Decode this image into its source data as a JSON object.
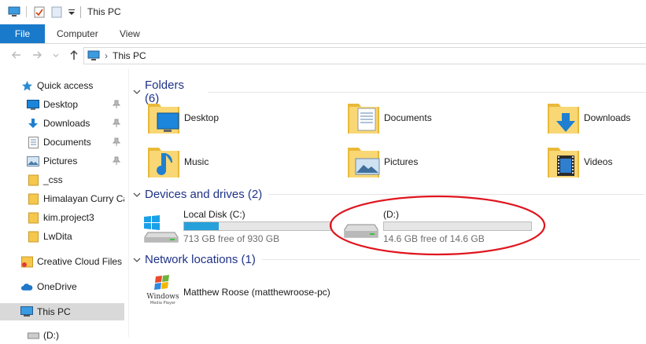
{
  "window": {
    "title": "This PC"
  },
  "ribbon": {
    "tabs": [
      {
        "label": "File",
        "active": true
      },
      {
        "label": "Computer"
      },
      {
        "label": "View"
      }
    ],
    "accent": "#1979ca"
  },
  "address": {
    "location": "This PC",
    "separator": "›"
  },
  "sidebar": {
    "items": [
      {
        "label": "Quick access",
        "icon": "star-icon"
      },
      {
        "label": "Desktop",
        "icon": "desktop-icon",
        "pinned": true
      },
      {
        "label": "Downloads",
        "icon": "download-icon",
        "pinned": true
      },
      {
        "label": "Documents",
        "icon": "documents-icon",
        "pinned": true
      },
      {
        "label": "Pictures",
        "icon": "pictures-icon",
        "pinned": true
      },
      {
        "label": "_css",
        "icon": "folder-icon"
      },
      {
        "label": "Himalayan Curry Ca",
        "icon": "folder-icon"
      },
      {
        "label": "kim.project3",
        "icon": "folder-icon"
      },
      {
        "label": "LwDita",
        "icon": "folder-icon"
      },
      {
        "label": "Creative Cloud Files",
        "icon": "creative-cloud-icon"
      },
      {
        "label": "OneDrive",
        "icon": "onedrive-icon"
      },
      {
        "label": "This PC",
        "icon": "computer-icon",
        "selected": true
      },
      {
        "label": "(D:)",
        "icon": "drive-icon"
      }
    ]
  },
  "sections": {
    "folders": {
      "title": "Folders (6)",
      "items": [
        {
          "label": "Desktop",
          "icon": "desktop-folder-icon"
        },
        {
          "label": "Documents",
          "icon": "documents-folder-icon"
        },
        {
          "label": "Downloads",
          "icon": "downloads-folder-icon"
        },
        {
          "label": "Music",
          "icon": "music-folder-icon"
        },
        {
          "label": "Pictures",
          "icon": "pictures-folder-icon"
        },
        {
          "label": "Videos",
          "icon": "videos-folder-icon"
        }
      ]
    },
    "devices": {
      "title": "Devices and drives (2)",
      "items": [
        {
          "name": "Local Disk (C:)",
          "free": "713 GB free of 930 GB",
          "used_fraction": 0.233,
          "icon": "windows-drive-icon"
        },
        {
          "name": "(D:)",
          "free": "14.6 GB free of 14.6 GB",
          "used_fraction": 0.0,
          "icon": "drive-icon"
        }
      ]
    },
    "network": {
      "title": "Network locations (1)",
      "items": [
        {
          "label": "Matthew Roose (matthewroose-pc)",
          "icon_text": "Windows",
          "icon_subtext": "Media Player"
        }
      ]
    }
  },
  "annotation": {
    "color": "#e0151e"
  }
}
